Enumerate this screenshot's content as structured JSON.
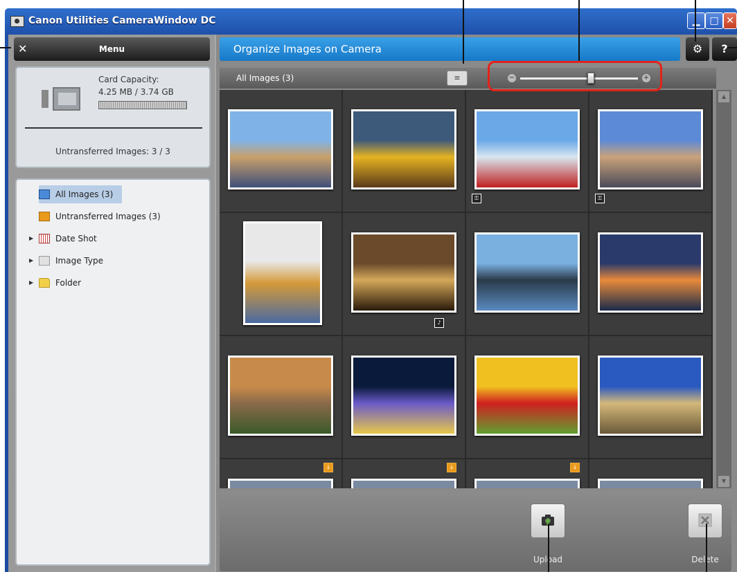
{
  "window": {
    "title": "Canon Utilities CameraWindow DC",
    "controls": {
      "minimize": "▁",
      "maximize": "□",
      "close": "✕"
    }
  },
  "left_panel": {
    "menu_label": "Menu",
    "close_glyph": "✕",
    "card": {
      "capacity_label": "Card Capacity:",
      "capacity_value": "4.25 MB / 3.74 GB",
      "untransferred": "Untransferred Images: 3 / 3"
    },
    "tree": [
      {
        "label": "All Images (3)",
        "icon": "all-images-icon",
        "selected": true,
        "expandable": false
      },
      {
        "label": "Untransferred Images (3)",
        "icon": "untransferred-icon",
        "selected": false,
        "expandable": false
      },
      {
        "label": "Date Shot",
        "icon": "calendar-icon",
        "selected": false,
        "expandable": true
      },
      {
        "label": "Image Type",
        "icon": "image-type-icon",
        "selected": false,
        "expandable": true
      },
      {
        "label": "Folder",
        "icon": "folder-icon",
        "selected": false,
        "expandable": true
      }
    ]
  },
  "header": {
    "title": "Organize Images on Camera",
    "settings_glyph": "⚙",
    "help_glyph": "?"
  },
  "gallery": {
    "title": "All Images (3)",
    "view_toggle_glyph": "≡",
    "zoom": {
      "minus": "−",
      "plus": "+",
      "level": 0.6
    },
    "thumbnails": [
      {
        "name": "harbour-stalls",
        "colors": [
          "#7fb3e8",
          "#c9a06a",
          "#3d4f7a"
        ],
        "badge": null
      },
      {
        "name": "yellow-train",
        "colors": [
          "#3d5a7a",
          "#e6b422",
          "#5a3a1a"
        ],
        "badge": null
      },
      {
        "name": "red-signpost",
        "colors": [
          "#6aa8e8",
          "#d8e6f0",
          "#c02020"
        ],
        "badge": "lock"
      },
      {
        "name": "city-towers",
        "colors": [
          "#5c8ad6",
          "#c9a27a",
          "#4a4a5a"
        ],
        "badge": "lock"
      },
      {
        "name": "hat-on-chair",
        "colors": [
          "#e8e8e8",
          "#d49a3a",
          "#4a6aa0"
        ],
        "badge": null,
        "portrait": true
      },
      {
        "name": "arcade-interior",
        "colors": [
          "#6a4a2a",
          "#d4a85a",
          "#2a1a0a"
        ],
        "badge": "sound"
      },
      {
        "name": "harbour-bridge",
        "colors": [
          "#7ab0e0",
          "#2a3a4a",
          "#5a8ac0"
        ],
        "badge": null
      },
      {
        "name": "sunset-bridge",
        "colors": [
          "#2a3a6a",
          "#e88a3a",
          "#1a2a4a"
        ],
        "badge": null
      },
      {
        "name": "wallaby",
        "colors": [
          "#c88a4a",
          "#8a6a4a",
          "#3a5a2a"
        ],
        "badge": null
      },
      {
        "name": "night-city",
        "colors": [
          "#0a1a3a",
          "#6a5ac8",
          "#e8c84a"
        ],
        "badge": null
      },
      {
        "name": "vegetable-sticks",
        "colors": [
          "#f0c020",
          "#d02020",
          "#60a030"
        ],
        "badge": null
      },
      {
        "name": "historic-building",
        "colors": [
          "#2a5ac0",
          "#d4b87a",
          "#6a5a3a"
        ],
        "badge": null
      }
    ],
    "partial_row_badges": [
      "untransferred",
      "untransferred",
      "untransferred",
      null
    ]
  },
  "actions": {
    "upload_label": "Upload",
    "delete_label": "Delete"
  },
  "colors": {
    "accent": "#1679c8",
    "callout_ring": "#e2231a",
    "untransferred_badge": "#e99a1a"
  }
}
